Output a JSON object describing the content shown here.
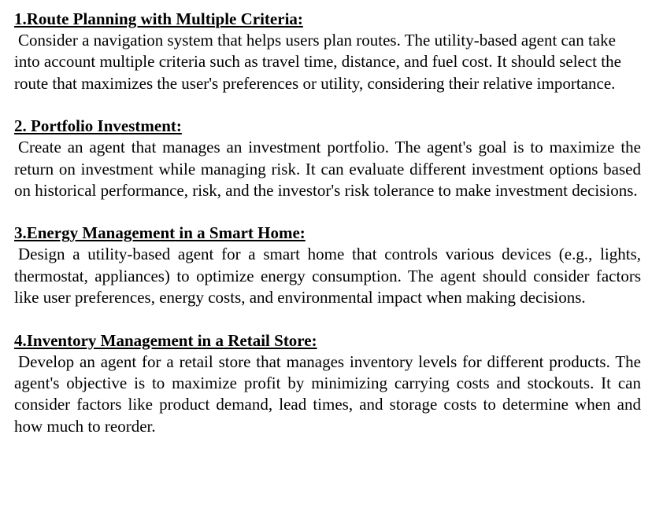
{
  "sections": [
    {
      "heading": "1.Route Planning with Multiple Criteria:",
      "text": "Consider a navigation system that helps users plan routes. The utility-based agent can take into account multiple criteria such as travel time, distance, and fuel cost. It should select the route that maximizes the user's preferences or utility, considering their relative importance."
    },
    {
      "heading": "2. Portfolio Investment:",
      "text": "Create an agent that manages an investment portfolio. The agent's goal is to maximize the return on investment while managing risk. It can evaluate different investment options based on historical performance, risk, and the investor's risk tolerance to make investment decisions."
    },
    {
      "heading": "3.Energy Management in a Smart Home:",
      "text": "Design a utility-based agent for a smart home that controls various devices (e.g., lights, thermostat, appliances) to optimize energy consumption. The agent should consider factors like user preferences, energy costs, and environmental impact when making decisions."
    },
    {
      "heading": "4.Inventory Management in a Retail Store:",
      "text": "Develop an agent for a retail store that manages inventory levels for different products. The agent's objective is to maximize profit by minimizing carrying costs and stockouts. It can consider factors like product demand, lead times, and storage costs to determine when and how much to reorder."
    }
  ]
}
